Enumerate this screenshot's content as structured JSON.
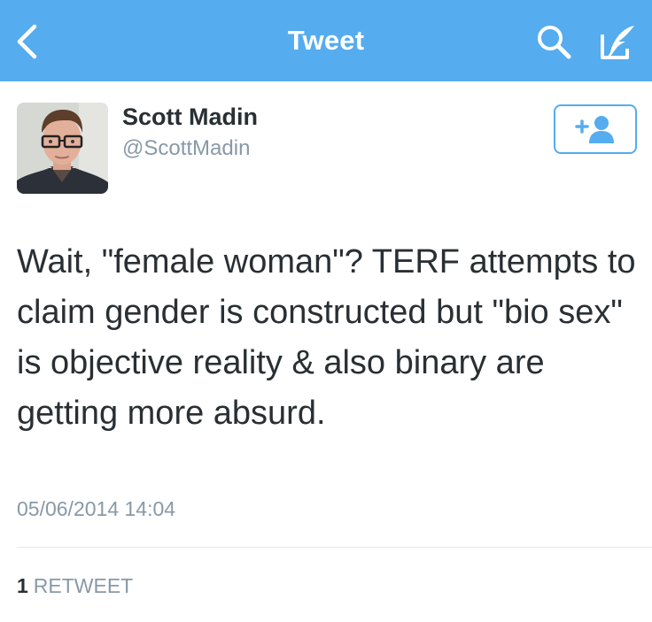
{
  "navbar": {
    "title": "Tweet",
    "background": "#55acee",
    "icons": {
      "back": "chevron-left-icon",
      "search": "search-icon",
      "compose": "compose-icon"
    }
  },
  "tweet": {
    "author": {
      "name": "Scott Madin",
      "handle": "@ScottMadin"
    },
    "follow_icon": "add-user-icon",
    "text": "Wait, \"female woman\"? TERF attempts to claim gender is constructed but \"bio sex\" is objective reality & also binary are getting more absurd.",
    "timestamp": "05/06/2014 14:04",
    "stats": {
      "retweet_count": "1",
      "retweet_label": "RETWEET"
    }
  },
  "colors": {
    "accent": "#55acee",
    "text": "#292f33",
    "secondary_text": "#8899a6",
    "divider": "#e1e8ed"
  }
}
